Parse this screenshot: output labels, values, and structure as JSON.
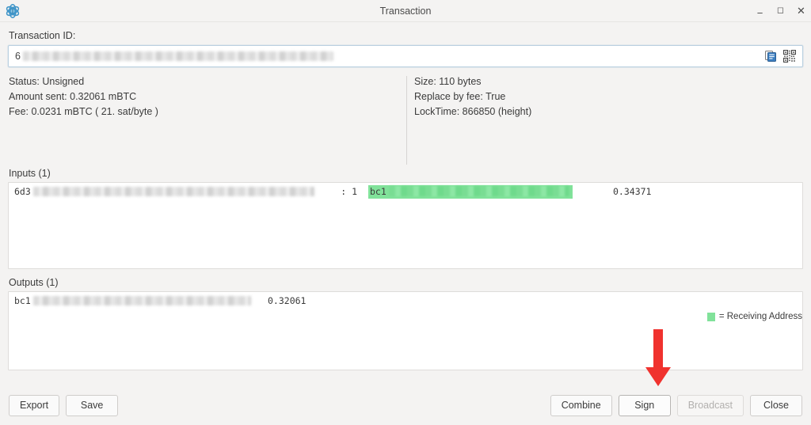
{
  "window": {
    "title": "Transaction",
    "app_icon": "electrum-atom-icon",
    "controls": {
      "minimize": "—",
      "maximize": "☐",
      "close": "✕"
    }
  },
  "txid": {
    "label": "Transaction ID:",
    "value_visible": "6",
    "value_redacted": true,
    "copy_icon": "copy-icon",
    "qr_icon": "qr-code-icon"
  },
  "details": {
    "left": [
      "Status: Unsigned",
      "Amount sent: 0.32061 mBTC",
      "Fee: 0.0231 mBTC  ( 21. sat/byte )"
    ],
    "right": [
      "Size: 110 bytes",
      "Replace by fee: True",
      "LockTime: 866850 (height)"
    ]
  },
  "inputs": {
    "label": "Inputs (1)",
    "rows": [
      {
        "txid_prefix": "6d3",
        "index": ": 1",
        "address_prefix": "bc1",
        "address_highlight": "#81e29a",
        "amount": "0.34371"
      }
    ]
  },
  "outputs": {
    "label": "Outputs (1)",
    "rows": [
      {
        "address_prefix": "bc1",
        "amount": "0.32061"
      }
    ]
  },
  "legend": {
    "swatch_color": "#81e29a",
    "text": "= Receiving Address"
  },
  "buttons": {
    "export": "Export",
    "save": "Save",
    "combine": "Combine",
    "sign": "Sign",
    "broadcast": "Broadcast",
    "close": "Close"
  },
  "annotation": {
    "arrow_color": "#f0322e",
    "points_to": "sign-button"
  }
}
